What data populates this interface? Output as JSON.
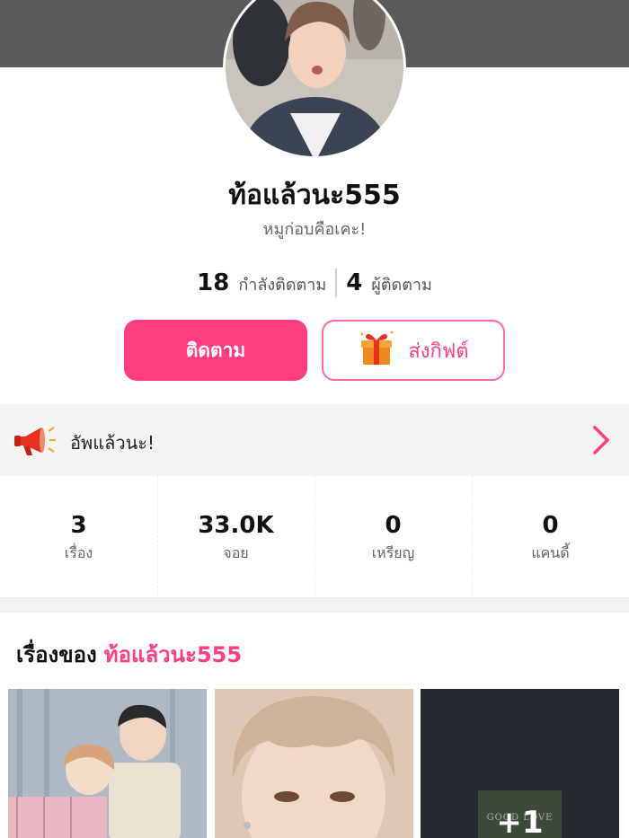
{
  "profile": {
    "username": "ท้อแล้วนะ555",
    "bio": "หมูก่อบคือเคะ!",
    "following_count": "18",
    "following_label": "กำลังติดตาม",
    "followers_count": "4",
    "followers_label": "ผู้ติดตาม"
  },
  "actions": {
    "follow_label": "ติดตาม",
    "gift_label": "ส่งกิฟต์"
  },
  "announcement": {
    "text": "อัพแล้วนะ!"
  },
  "stats": [
    {
      "value": "3",
      "label": "เรื่อง"
    },
    {
      "value": "33.0K",
      "label": "จอย"
    },
    {
      "value": "0",
      "label": "เหรียญ"
    },
    {
      "value": "0",
      "label": "แคนดี้"
    }
  ],
  "stories": {
    "heading_prefix": "เรื่องของ",
    "heading_owner": "ท้อแล้วนะ555",
    "more_count_label": "+1",
    "more_thumb_text": "GOOD LOVE"
  },
  "colors": {
    "accent": "#ff3d7f",
    "banner": "#5a5a5a",
    "announce_bg": "#f4f4f4"
  },
  "icons": {
    "announcement": "megaphone-icon",
    "chevron": "chevron-right-icon",
    "gift": "gift-box-icon"
  }
}
